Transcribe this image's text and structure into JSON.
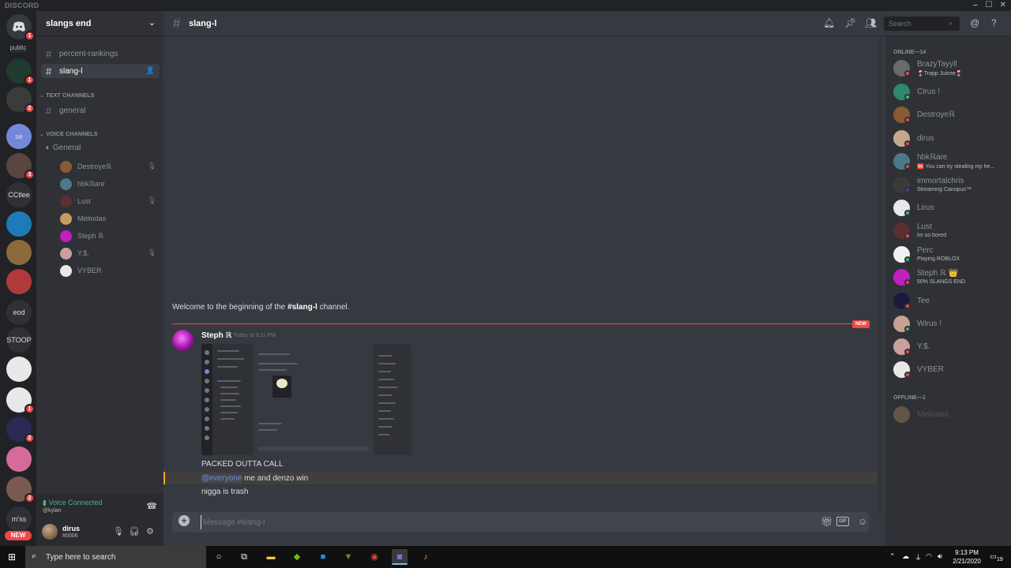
{
  "window": {
    "brand": "DISCORD",
    "minimize": "–",
    "maximize": "☐",
    "close": "✕"
  },
  "guilds": {
    "home_badge": "1",
    "public_label": "public",
    "items": [
      {
        "label": "",
        "badge": "1",
        "color": "#1f3a2e"
      },
      {
        "label": "",
        "badge": "2",
        "color": "#3b3b3b"
      },
      {
        "label": "se",
        "badge": "",
        "color": "#7289da"
      },
      {
        "label": "",
        "badge": "3",
        "color": "#5a4540"
      },
      {
        "label": "CCtlee",
        "badge": "",
        "color": "#2f3136"
      },
      {
        "label": "",
        "badge": "",
        "color": "#1e7bb8"
      },
      {
        "label": "",
        "badge": "",
        "color": "#8a6a3a"
      },
      {
        "label": "",
        "badge": "",
        "color": "#b03a3a"
      },
      {
        "label": "eod",
        "badge": "",
        "color": "#2f3136"
      },
      {
        "label": "STOOP",
        "badge": "",
        "color": "#2f3136"
      },
      {
        "label": "",
        "badge": "",
        "color": "#e8e8e8"
      },
      {
        "label": "",
        "badge": "1",
        "color": "#e8e8e8"
      },
      {
        "label": "",
        "badge": "2",
        "color": "#2a2a55"
      },
      {
        "label": "",
        "badge": "",
        "color": "#d66a9a"
      },
      {
        "label": "",
        "badge": "2",
        "color": "#7a5a50"
      },
      {
        "label": "m'ss",
        "badge": "",
        "color": "#2f3136"
      }
    ],
    "new_label": "NEW"
  },
  "server": {
    "name": "slangs end",
    "chevron": "⌄"
  },
  "channels": {
    "top": [
      {
        "name": "percent-rankings"
      },
      {
        "name": "slang-l"
      }
    ],
    "text_category": "TEXT CHANNELS",
    "text": [
      {
        "name": "general"
      }
    ],
    "voice_category": "VOICE CHANNELS",
    "voice_channel": "General",
    "voice_users": [
      {
        "name": "Destroyeℝ",
        "muted": true,
        "color": "#8a5a30"
      },
      {
        "name": "hbkℝare",
        "muted": false,
        "color": "#4a7a8a"
      },
      {
        "name": "Lust",
        "muted": true,
        "color": "#5a3030"
      },
      {
        "name": "Meliodas",
        "muted": false,
        "color": "#c89a60"
      },
      {
        "name": "Steph ℝ",
        "muted": false,
        "color": "#c020c0"
      },
      {
        "name": "Y.$.",
        "muted": true,
        "color": "#c8a0a0"
      },
      {
        "name": "VYBER",
        "muted": false,
        "color": "#e8e8e8"
      }
    ]
  },
  "voice_panel": {
    "status": "Voice Connected",
    "sub": "@kylan"
  },
  "user": {
    "name": "dirus",
    "tag": "#0006"
  },
  "chat": {
    "channel": "slang-l",
    "search_placeholder": "Search",
    "welcome_prefix": "Welcome to the beginning of the ",
    "welcome_channel": "#slang-l",
    "welcome_suffix": " channel.",
    "new_label": "NEW",
    "message": {
      "author": "Steph ℝ",
      "time": "Today at 9:11 PM",
      "lines": [
        "PACKED OUTTA CALL"
      ],
      "mention": "@everyone",
      "mention_rest": " me and denzo win",
      "last": "nigga is trash"
    },
    "composer_placeholder": "Message #slang-l"
  },
  "members": {
    "online_label": "ONLINE—14",
    "online": [
      {
        "name": "BrazyTayyll",
        "sub": "🍷Trapp Juicee🍷",
        "status": "#f04747",
        "color": "#6a6a6a"
      },
      {
        "name": "Cirus !",
        "sub": "",
        "status": "#43b581",
        "color": "#2a8a6a"
      },
      {
        "name": "Destroyeℝ",
        "sub": "",
        "status": "#f04747",
        "color": "#8a5a30"
      },
      {
        "name": "dirus",
        "sub": "",
        "status": "#f04747",
        "color": "#c3a98b"
      },
      {
        "name": "hbkℝare",
        "sub": "🆘 You can try stealing my he...",
        "status": "#f04747",
        "color": "#4a7a8a"
      },
      {
        "name": "immortalchris",
        "sub": "Streaming Canopus™",
        "status": "#593695",
        "color": "#3a3a3a"
      },
      {
        "name": "Lirus",
        "sub": "",
        "status": "#43b581",
        "color": "#e8e8e8"
      },
      {
        "name": "Lust",
        "sub": "Im so bored",
        "status": "#f04747",
        "color": "#5a3030"
      },
      {
        "name": "Perc",
        "sub": "Playing ROBLOX",
        "status": "#43b581",
        "color": "#f0f0f0"
      },
      {
        "name": "Steph ℝ 👑",
        "sub": "50% SLANGS END",
        "status": "#f04747",
        "color": "#c020c0"
      },
      {
        "name": "Tee",
        "sub": "",
        "status": "#f04747",
        "color": "#1a1a40"
      },
      {
        "name": "Wirus !",
        "sub": "",
        "status": "#43b581",
        "color": "#c8a090"
      },
      {
        "name": "Y.$.",
        "sub": "",
        "status": "#f04747",
        "color": "#c8a0a0"
      },
      {
        "name": "VYBER",
        "sub": "",
        "status": "#f04747",
        "color": "#e8e8e8"
      }
    ],
    "offline_label": "OFFLINE—1",
    "offline": [
      {
        "name": "Meliodas",
        "color": "#c89a60"
      }
    ]
  },
  "taskbar": {
    "search_placeholder": "Type here to search",
    "time": "9:13 PM",
    "date": "2/21/2020",
    "notif_count": "19"
  }
}
